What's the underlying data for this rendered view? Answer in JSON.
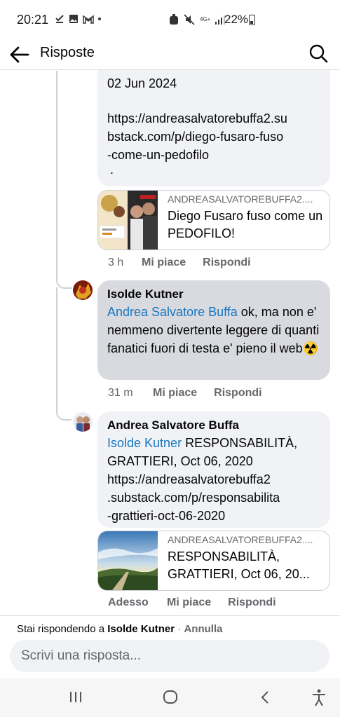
{
  "status_bar": {
    "time": "20:21",
    "network": "4G+",
    "battery": "22%"
  },
  "header": {
    "title": "Risposte"
  },
  "comments": [
    {
      "date_line": "02 Jun 2024",
      "link": "https://andreasalvatorebuffa2.substack.com/p/diego-fusaro-fuso-come-un-pedofilo",
      "link_lines": [
        "https://andreasalvatorebuffa2.su",
        "bstack.com/p/diego-fusaro-fuso",
        "-come-un-pedofilo"
      ],
      "trailing": ".",
      "preview": {
        "source": "ANDREASALVATOREBUFFA2....",
        "title": "Diego Fusaro fuso come un PEDOFILO!"
      },
      "time": "3 h",
      "like": "Mi piace",
      "reply": "Rispondi"
    },
    {
      "author": "Isolde Kutner",
      "mention": "Andrea Salvatore Buffa",
      "text": " ok, ma non e' nemmeno divertente leggere di quanti fanatici fuori di testa e' pieno il web",
      "emoji": "☢️",
      "time": "31 m",
      "like": "Mi piace",
      "reply": "Rispondi"
    },
    {
      "author": "Andrea Salvatore Buffa",
      "mention": "Isolde Kutner",
      "text": " RESPONSABILITÀ, GRATTIERI, Oct 06, 2020",
      "link_lines": [
        "https://andreasalvatorebuffa2",
        ".substack.com/p/responsabilita",
        "-grattieri-oct-06-2020"
      ],
      "preview": {
        "source": "ANDREASALVATOREBUFFA2....",
        "title": "RESPONSABILITÀ, GRATTIERI, Oct 06, 20..."
      },
      "time": "Adesso",
      "like": "Mi piace",
      "reply": "Rispondi"
    }
  ],
  "reply_bar": {
    "prefix": "Stai rispondendo a ",
    "target": "Isolde Kutner",
    "separator": " · ",
    "cancel": "Annulla",
    "placeholder": "Scrivi una risposta..."
  },
  "colors": {
    "link": "#1877c0",
    "bubble": "#f0f2f5",
    "bubble_active": "#d8dadf",
    "meta": "#65676b"
  },
  "icons": [
    "back-arrow-icon",
    "search-icon",
    "recents-icon",
    "home-icon",
    "back-nav-icon",
    "accessibility-icon"
  ]
}
